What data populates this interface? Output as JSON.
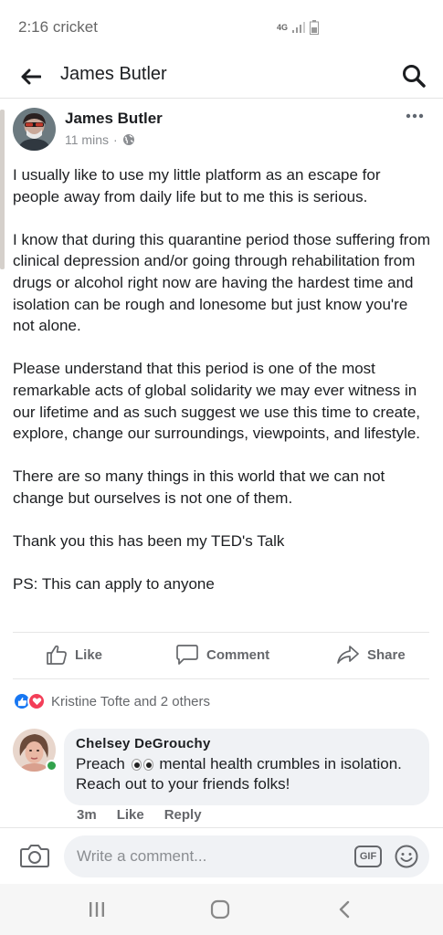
{
  "status_bar": {
    "time": "2:16",
    "carrier": "cricket",
    "network": "4G"
  },
  "app_bar": {
    "title": "James Butler"
  },
  "post": {
    "author": "James Butler",
    "time_ago": "11 mins",
    "separator": "·",
    "paragraphs": [
      "I usually like to use my little platform as an escape for people away from daily life but to me this is serious.",
      "I know that during this quarantine period those suffering from clinical depression and/or going through rehabilitation from drugs or alcohol right now are having the hardest time and isolation can be rough and lonesome but just know you're not alone.",
      "Please understand that this period is one of the most remarkable acts of global solidarity we may ever witness in our lifetime and as such suggest we use this time to create, explore, change our surroundings, viewpoints, and lifestyle.",
      "There are so many things in this world that we can not change but ourselves is not one of them.",
      "Thank you this has been my TED's Talk",
      "PS: This can apply to anyone"
    ]
  },
  "actions": {
    "like": "Like",
    "comment": "Comment",
    "share": "Share"
  },
  "reactions": {
    "summary": "Kristine Tofte and 2 others"
  },
  "comment": {
    "author": "Chelsey DeGrouchy",
    "text_before": "Preach",
    "text_after": "mental health crumbles in isolation. Reach out to your friends folks!",
    "time": "3m",
    "like": "Like",
    "reply": "Reply"
  },
  "composer": {
    "placeholder": "Write a comment...",
    "gif_label": "GIF"
  },
  "colors": {
    "facebook_blue": "#1877f2",
    "love_red": "#f33e58",
    "online_green": "#31a24c",
    "secondary_text": "#65676b"
  }
}
